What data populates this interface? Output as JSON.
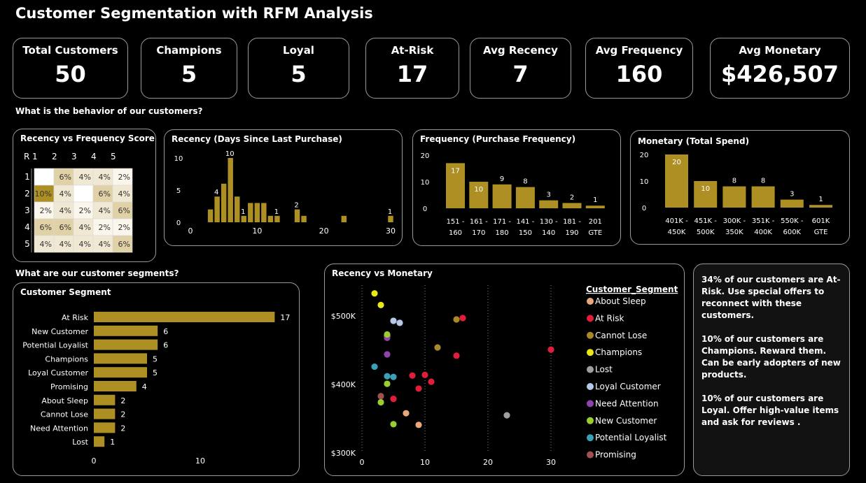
{
  "title": "Customer Segmentation with RFM Analysis",
  "kpis": [
    {
      "label": "Total Customers",
      "value": "50"
    },
    {
      "label": "Champions",
      "value": "5"
    },
    {
      "label": "Loyal",
      "value": "5"
    },
    {
      "label": "At-Risk",
      "value": "17"
    },
    {
      "label": "Avg Recency",
      "value": "7"
    },
    {
      "label": "Avg Frequency",
      "value": "160"
    },
    {
      "label": "Avg Monetary",
      "value": "$426,507"
    }
  ],
  "questions": {
    "behavior": "What is the behavior of our customers?",
    "segments": "What are our customer segments?"
  },
  "insights": [
    "34% of our customers are At-Risk. Use special offers to reconnect with these customers.",
    "10% of our customers are Champions.  Reward them.  Can be early adopters of new products.",
    "10% of our customers are Loyal. Offer high-value items and ask for reviews ."
  ],
  "chart_data": [
    {
      "type": "heatmap",
      "title": "Recency vs Frequency Score",
      "row_header": "R",
      "columns": [
        "1",
        "2",
        "3",
        "4",
        "5"
      ],
      "rows": [
        "1",
        "2",
        "3",
        "4",
        "5"
      ],
      "values": [
        [
          "",
          "6%",
          "4%",
          "4%",
          "2%"
        ],
        [
          "10%",
          "4%",
          "",
          "6%",
          "4%"
        ],
        [
          "2%",
          "4%",
          "2%",
          "4%",
          "6%"
        ],
        [
          "6%",
          "6%",
          "4%",
          "2%",
          "2%"
        ],
        [
          "4%",
          "4%",
          "4%",
          "4%",
          "6%"
        ]
      ]
    },
    {
      "type": "bar",
      "title": "Recency (Days Since Last Purchase)",
      "x": [
        3,
        4,
        5,
        6,
        7,
        8,
        9,
        10,
        11,
        12,
        13,
        16,
        17,
        23,
        30
      ],
      "values": [
        2,
        4,
        6,
        10,
        4,
        1,
        3,
        3,
        3,
        1,
        1,
        2,
        1,
        1,
        1
      ],
      "data_labels": [
        {
          "x": 4,
          "y": 4,
          "text": "4"
        },
        {
          "x": 6,
          "y": 10,
          "text": "10"
        },
        {
          "x": 8,
          "y": 1,
          "text": "1"
        },
        {
          "x": 13,
          "y": 1,
          "text": "1"
        },
        {
          "x": 16,
          "y": 2,
          "text": "2"
        },
        {
          "x": 30,
          "y": 1,
          "text": "1"
        }
      ],
      "xlim": [
        0,
        30
      ],
      "ylim": [
        0,
        10
      ],
      "xticks": [
        "0",
        "10",
        "20",
        "30"
      ],
      "yticks": [
        "0",
        "5",
        "10"
      ]
    },
    {
      "type": "bar",
      "title": "Frequency (Purchase Frequency)",
      "categories": [
        "151 - 160",
        "161 - 170",
        "171 - 180",
        "141 - 150",
        "130 - 140",
        "181 - 190",
        "201 GTE"
      ],
      "values": [
        17,
        10,
        9,
        8,
        3,
        2,
        1
      ],
      "ylim": [
        0,
        20
      ],
      "yticks": [
        "0",
        "10",
        "20"
      ]
    },
    {
      "type": "bar",
      "title": "Monetary (Total Spend)",
      "categories": [
        "401K - 450K",
        "451K - 500K",
        "300K - 350K",
        "351K - 400K",
        "550K - 600K",
        "601K GTE"
      ],
      "values": [
        20,
        10,
        8,
        8,
        3,
        1
      ],
      "ylim": [
        0,
        20
      ],
      "yticks": [
        "0",
        "10",
        "20"
      ]
    },
    {
      "type": "bar",
      "orientation": "horizontal",
      "title": "Customer Segment",
      "categories": [
        "At Risk",
        "New Customer",
        "Potential Loyalist",
        "Champions",
        "Loyal Customer",
        "Promising",
        "About Sleep",
        "Cannot Lose",
        "Need Attention",
        "Lost"
      ],
      "values": [
        17,
        6,
        6,
        5,
        5,
        4,
        2,
        2,
        2,
        1
      ],
      "xticks": [
        "0",
        "10"
      ]
    },
    {
      "type": "scatter",
      "title": "Recency vs Monetary",
      "legend_title": "Customer_Segment",
      "legend_position": "right",
      "xlim": [
        0,
        33
      ],
      "ylim": [
        300000,
        545000
      ],
      "xticks": [
        "0",
        "10",
        "20",
        "30"
      ],
      "yticks": [
        "$300K",
        "$400K",
        "$500K"
      ],
      "series": [
        {
          "name": "About Sleep",
          "color": "#e8a87c",
          "points": [
            [
              7,
              358000
            ],
            [
              9,
              341000
            ]
          ]
        },
        {
          "name": "At Risk",
          "color": "#e01e3c",
          "points": [
            [
              16,
              497000
            ],
            [
              15,
              442000
            ],
            [
              30,
              451000
            ],
            [
              8,
              413000
            ],
            [
              10,
              414000
            ],
            [
              11,
              404000
            ],
            [
              9,
              394000
            ],
            [
              5,
              379000
            ]
          ]
        },
        {
          "name": "Cannot Lose",
          "color": "#a7892a",
          "points": [
            [
              15,
              495000
            ],
            [
              12,
              454000
            ]
          ]
        },
        {
          "name": "Champions",
          "color": "#e8e817",
          "points": [
            [
              2,
              533000
            ],
            [
              3,
              516000
            ],
            [
              4,
              471000
            ]
          ]
        },
        {
          "name": "Lost",
          "color": "#9e9e9e",
          "points": [
            [
              23,
              355000
            ]
          ]
        },
        {
          "name": "Loyal Customer",
          "color": "#b7c9e8",
          "points": [
            [
              5,
              493000
            ],
            [
              6,
              490000
            ]
          ]
        },
        {
          "name": "Need Attention",
          "color": "#8e44ad",
          "points": [
            [
              4,
              468000
            ],
            [
              4,
              444000
            ]
          ]
        },
        {
          "name": "New Customer",
          "color": "#9acd32",
          "points": [
            [
              4,
              473000
            ],
            [
              4,
              401000
            ],
            [
              3,
              374000
            ],
            [
              5,
              342000
            ]
          ]
        },
        {
          "name": "Potential Loyalist",
          "color": "#3aa0b8",
          "points": [
            [
              2,
              426000
            ],
            [
              4,
              412000
            ],
            [
              5,
              411000
            ]
          ]
        },
        {
          "name": "Promising",
          "color": "#a35050",
          "points": [
            [
              3,
              383000
            ]
          ]
        }
      ]
    }
  ]
}
